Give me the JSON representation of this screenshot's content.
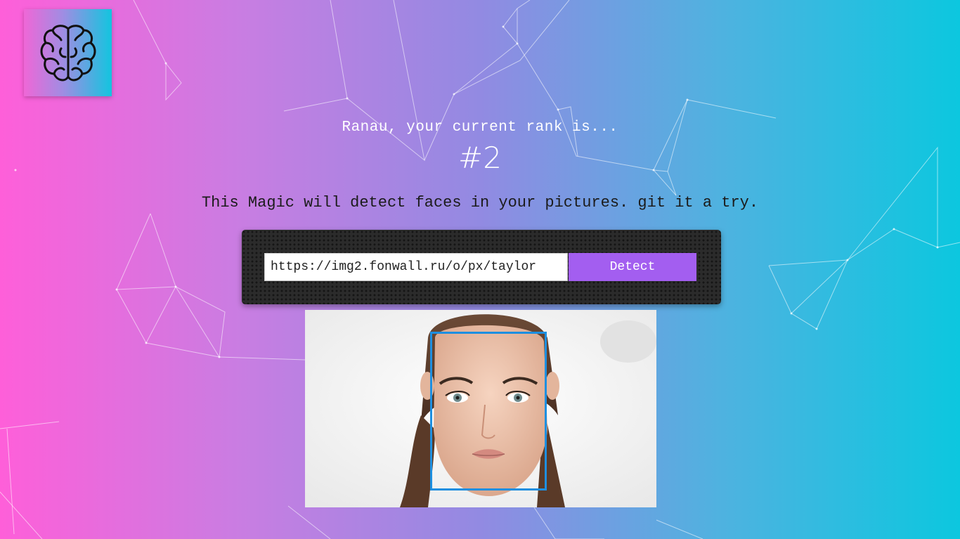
{
  "header": {
    "rank_text": "Ranau, your current rank is...",
    "rank_value": "#2"
  },
  "main": {
    "tagline": "This Magic will detect faces in your pictures. git it a try.",
    "url_input": {
      "value": "https://img2.fonwall.ru/o/px/taylor"
    },
    "detect_label": "Detect"
  },
  "colors": {
    "gradient_left": "#fe5fd9",
    "gradient_right": "#0cc7df",
    "detect_button": "#a35ef0",
    "face_box": "#1e8fe0",
    "panel": "#2b2b2b"
  },
  "icons": {
    "logo": "brain-icon"
  }
}
